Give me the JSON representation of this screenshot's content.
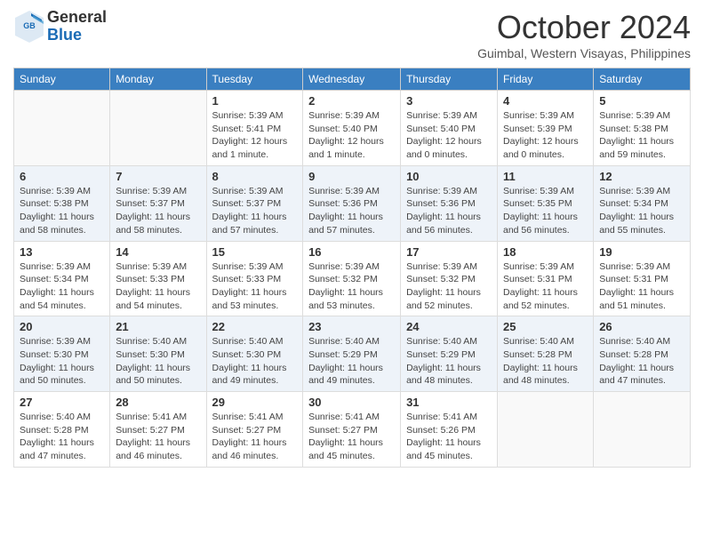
{
  "header": {
    "logo_general": "General",
    "logo_blue": "Blue",
    "month": "October 2024",
    "location": "Guimbal, Western Visayas, Philippines"
  },
  "days_of_week": [
    "Sunday",
    "Monday",
    "Tuesday",
    "Wednesday",
    "Thursday",
    "Friday",
    "Saturday"
  ],
  "weeks": [
    [
      {
        "day": "",
        "sunrise": "",
        "sunset": "",
        "daylight": ""
      },
      {
        "day": "",
        "sunrise": "",
        "sunset": "",
        "daylight": ""
      },
      {
        "day": "1",
        "sunrise": "Sunrise: 5:39 AM",
        "sunset": "Sunset: 5:41 PM",
        "daylight": "Daylight: 12 hours and 1 minute."
      },
      {
        "day": "2",
        "sunrise": "Sunrise: 5:39 AM",
        "sunset": "Sunset: 5:40 PM",
        "daylight": "Daylight: 12 hours and 1 minute."
      },
      {
        "day": "3",
        "sunrise": "Sunrise: 5:39 AM",
        "sunset": "Sunset: 5:40 PM",
        "daylight": "Daylight: 12 hours and 0 minutes."
      },
      {
        "day": "4",
        "sunrise": "Sunrise: 5:39 AM",
        "sunset": "Sunset: 5:39 PM",
        "daylight": "Daylight: 12 hours and 0 minutes."
      },
      {
        "day": "5",
        "sunrise": "Sunrise: 5:39 AM",
        "sunset": "Sunset: 5:38 PM",
        "daylight": "Daylight: 11 hours and 59 minutes."
      }
    ],
    [
      {
        "day": "6",
        "sunrise": "Sunrise: 5:39 AM",
        "sunset": "Sunset: 5:38 PM",
        "daylight": "Daylight: 11 hours and 58 minutes."
      },
      {
        "day": "7",
        "sunrise": "Sunrise: 5:39 AM",
        "sunset": "Sunset: 5:37 PM",
        "daylight": "Daylight: 11 hours and 58 minutes."
      },
      {
        "day": "8",
        "sunrise": "Sunrise: 5:39 AM",
        "sunset": "Sunset: 5:37 PM",
        "daylight": "Daylight: 11 hours and 57 minutes."
      },
      {
        "day": "9",
        "sunrise": "Sunrise: 5:39 AM",
        "sunset": "Sunset: 5:36 PM",
        "daylight": "Daylight: 11 hours and 57 minutes."
      },
      {
        "day": "10",
        "sunrise": "Sunrise: 5:39 AM",
        "sunset": "Sunset: 5:36 PM",
        "daylight": "Daylight: 11 hours and 56 minutes."
      },
      {
        "day": "11",
        "sunrise": "Sunrise: 5:39 AM",
        "sunset": "Sunset: 5:35 PM",
        "daylight": "Daylight: 11 hours and 56 minutes."
      },
      {
        "day": "12",
        "sunrise": "Sunrise: 5:39 AM",
        "sunset": "Sunset: 5:34 PM",
        "daylight": "Daylight: 11 hours and 55 minutes."
      }
    ],
    [
      {
        "day": "13",
        "sunrise": "Sunrise: 5:39 AM",
        "sunset": "Sunset: 5:34 PM",
        "daylight": "Daylight: 11 hours and 54 minutes."
      },
      {
        "day": "14",
        "sunrise": "Sunrise: 5:39 AM",
        "sunset": "Sunset: 5:33 PM",
        "daylight": "Daylight: 11 hours and 54 minutes."
      },
      {
        "day": "15",
        "sunrise": "Sunrise: 5:39 AM",
        "sunset": "Sunset: 5:33 PM",
        "daylight": "Daylight: 11 hours and 53 minutes."
      },
      {
        "day": "16",
        "sunrise": "Sunrise: 5:39 AM",
        "sunset": "Sunset: 5:32 PM",
        "daylight": "Daylight: 11 hours and 53 minutes."
      },
      {
        "day": "17",
        "sunrise": "Sunrise: 5:39 AM",
        "sunset": "Sunset: 5:32 PM",
        "daylight": "Daylight: 11 hours and 52 minutes."
      },
      {
        "day": "18",
        "sunrise": "Sunrise: 5:39 AM",
        "sunset": "Sunset: 5:31 PM",
        "daylight": "Daylight: 11 hours and 52 minutes."
      },
      {
        "day": "19",
        "sunrise": "Sunrise: 5:39 AM",
        "sunset": "Sunset: 5:31 PM",
        "daylight": "Daylight: 11 hours and 51 minutes."
      }
    ],
    [
      {
        "day": "20",
        "sunrise": "Sunrise: 5:39 AM",
        "sunset": "Sunset: 5:30 PM",
        "daylight": "Daylight: 11 hours and 50 minutes."
      },
      {
        "day": "21",
        "sunrise": "Sunrise: 5:40 AM",
        "sunset": "Sunset: 5:30 PM",
        "daylight": "Daylight: 11 hours and 50 minutes."
      },
      {
        "day": "22",
        "sunrise": "Sunrise: 5:40 AM",
        "sunset": "Sunset: 5:30 PM",
        "daylight": "Daylight: 11 hours and 49 minutes."
      },
      {
        "day": "23",
        "sunrise": "Sunrise: 5:40 AM",
        "sunset": "Sunset: 5:29 PM",
        "daylight": "Daylight: 11 hours and 49 minutes."
      },
      {
        "day": "24",
        "sunrise": "Sunrise: 5:40 AM",
        "sunset": "Sunset: 5:29 PM",
        "daylight": "Daylight: 11 hours and 48 minutes."
      },
      {
        "day": "25",
        "sunrise": "Sunrise: 5:40 AM",
        "sunset": "Sunset: 5:28 PM",
        "daylight": "Daylight: 11 hours and 48 minutes."
      },
      {
        "day": "26",
        "sunrise": "Sunrise: 5:40 AM",
        "sunset": "Sunset: 5:28 PM",
        "daylight": "Daylight: 11 hours and 47 minutes."
      }
    ],
    [
      {
        "day": "27",
        "sunrise": "Sunrise: 5:40 AM",
        "sunset": "Sunset: 5:28 PM",
        "daylight": "Daylight: 11 hours and 47 minutes."
      },
      {
        "day": "28",
        "sunrise": "Sunrise: 5:41 AM",
        "sunset": "Sunset: 5:27 PM",
        "daylight": "Daylight: 11 hours and 46 minutes."
      },
      {
        "day": "29",
        "sunrise": "Sunrise: 5:41 AM",
        "sunset": "Sunset: 5:27 PM",
        "daylight": "Daylight: 11 hours and 46 minutes."
      },
      {
        "day": "30",
        "sunrise": "Sunrise: 5:41 AM",
        "sunset": "Sunset: 5:27 PM",
        "daylight": "Daylight: 11 hours and 45 minutes."
      },
      {
        "day": "31",
        "sunrise": "Sunrise: 5:41 AM",
        "sunset": "Sunset: 5:26 PM",
        "daylight": "Daylight: 11 hours and 45 minutes."
      },
      {
        "day": "",
        "sunrise": "",
        "sunset": "",
        "daylight": ""
      },
      {
        "day": "",
        "sunrise": "",
        "sunset": "",
        "daylight": ""
      }
    ]
  ]
}
